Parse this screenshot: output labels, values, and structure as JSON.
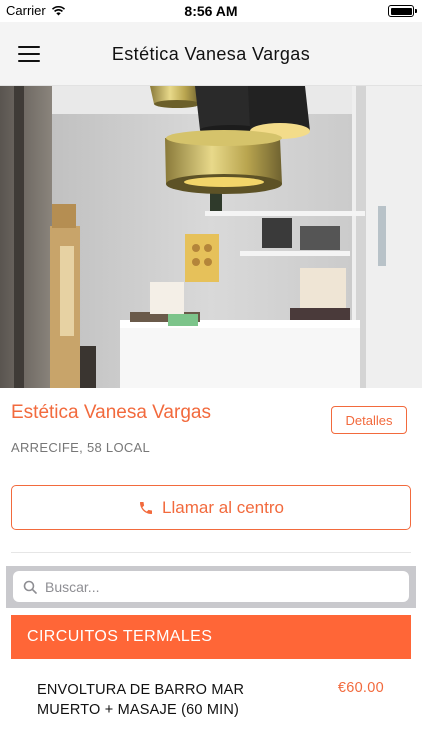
{
  "status_bar": {
    "carrier": "Carrier",
    "time": "8:56 AM"
  },
  "nav": {
    "title": "Estética Vanesa Vargas"
  },
  "center": {
    "name": "Estética Vanesa Vargas",
    "details_label": "Detalles",
    "address": "ARRECIFE, 58 LOCAL",
    "call_label": "Llamar al centro"
  },
  "search": {
    "placeholder": "Buscar..."
  },
  "category": {
    "title": "CIRCUITOS TERMALES"
  },
  "services": [
    {
      "name": "ENVOLTURA DE BARRO MAR MUERTO + MASAJE (60 MIN)",
      "price": "€60.00"
    }
  ],
  "colors": {
    "accent": "#f26a3d",
    "category_bg": "#ff6637",
    "nav_bg": "#f4f4f4"
  },
  "icons": {
    "menu": "hamburger-menu-icon",
    "phone": "phone-icon",
    "search": "search-icon",
    "wifi": "wifi-icon",
    "battery": "battery-icon"
  }
}
